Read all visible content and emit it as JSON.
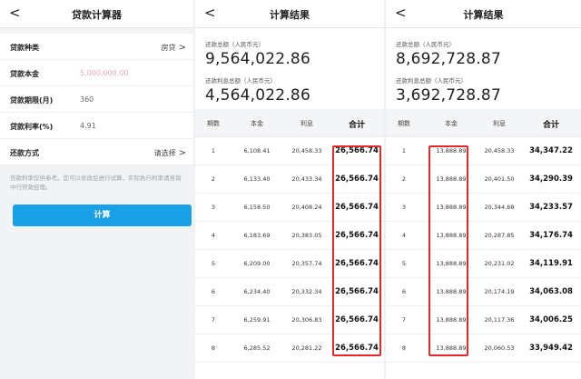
{
  "calculator": {
    "back": "<",
    "title": "贷款计算器",
    "rows": [
      {
        "label": "贷款种类",
        "value": "",
        "right": "房贷",
        "chev": ">"
      },
      {
        "label": "贷款本金",
        "value": "5,000,000.00",
        "right": "",
        "chev": ""
      },
      {
        "label": "贷款期限(月)",
        "value": "360",
        "right": "",
        "chev": ""
      },
      {
        "label": "贷款利率(%)",
        "value": "4.91",
        "right": "",
        "chev": ""
      },
      {
        "label": "还款方式",
        "value": "",
        "right": "请选择",
        "chev": ">"
      }
    ],
    "note": "贷款利率仅供参考。您可以修改后进行试算，实际执行利率请咨询中行贷款经理。",
    "calc_button": "计算"
  },
  "result1": {
    "back": "<",
    "title": "计算结果",
    "total_label": "还款总额（人民币元）",
    "total_value": "9,564,022.86",
    "interest_label": "还款利息总额（人民币元）",
    "interest_value": "4,564,022.86",
    "headers": [
      "期数",
      "本金",
      "利息",
      "合计"
    ],
    "rows": [
      [
        "1",
        "6,108.41",
        "20,458.33",
        "26,566.74"
      ],
      [
        "2",
        "6,133.40",
        "20,433.34",
        "26,566.74"
      ],
      [
        "3",
        "6,158.50",
        "20,408.24",
        "26,566.74"
      ],
      [
        "4",
        "6,183.69",
        "20,383.05",
        "26,566.74"
      ],
      [
        "5",
        "6,209.00",
        "20,357.74",
        "26,566.74"
      ],
      [
        "6",
        "6,234.40",
        "20,332.34",
        "26,566.74"
      ],
      [
        "7",
        "6,259.91",
        "20,306.83",
        "26,566.74"
      ],
      [
        "8",
        "6,285.52",
        "20,281.22",
        "26,566.74"
      ]
    ]
  },
  "result2": {
    "back": "<",
    "title": "计算结果",
    "total_label": "还款总额（人民币元）",
    "total_value": "8,692,728.87",
    "interest_label": "还款利息总额（人民币元）",
    "interest_value": "3,692,728.87",
    "headers": [
      "期数",
      "本金",
      "利息",
      "合计"
    ],
    "rows": [
      [
        "1",
        "13,888.89",
        "20,458.33",
        "34,347.22"
      ],
      [
        "2",
        "13,888.89",
        "20,401.50",
        "34,290.39"
      ],
      [
        "3",
        "13,888.89",
        "20,344.68",
        "34,233.57"
      ],
      [
        "4",
        "13,888.89",
        "20,287.85",
        "34,176.74"
      ],
      [
        "5",
        "13,888.89",
        "20,231.02",
        "34,119.91"
      ],
      [
        "6",
        "13,888.89",
        "20,174.19",
        "34,063.08"
      ],
      [
        "7",
        "13,888.89",
        "20,117.36",
        "34,006.25"
      ],
      [
        "8",
        "13,888.89",
        "20,060.53",
        "33,949.42"
      ]
    ]
  },
  "colors": {
    "accent": "#1aa0e6",
    "highlight": "#e02b2b",
    "pink_value": "#e9a9b4"
  }
}
